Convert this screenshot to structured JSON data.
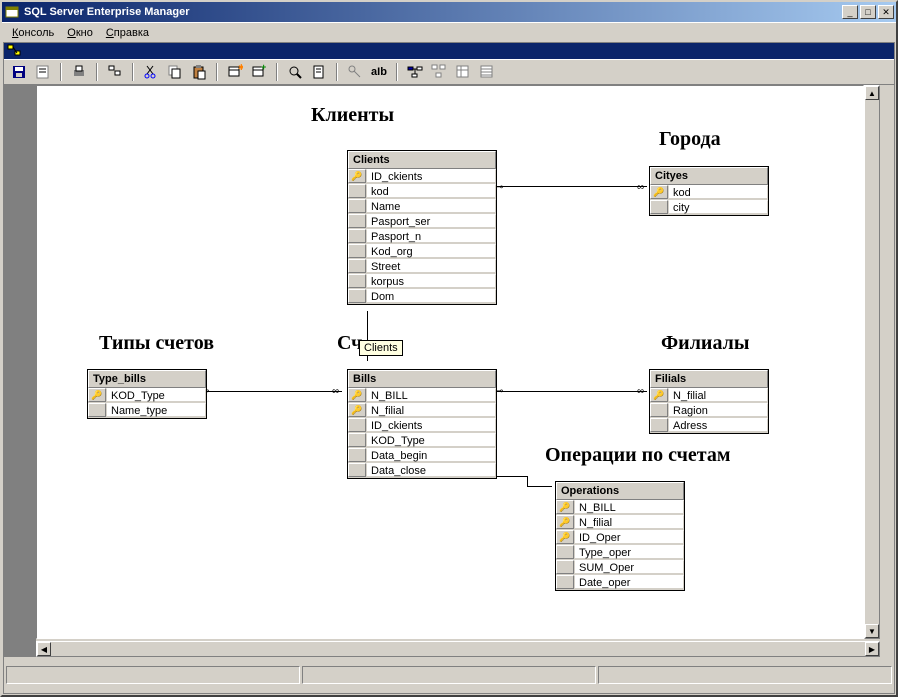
{
  "window": {
    "title": "SQL Server Enterprise Manager"
  },
  "menu": {
    "console": "Консоль",
    "window": "Окно",
    "help": "Справка"
  },
  "toolbar": {
    "alb": "aIb"
  },
  "labels": {
    "clients": "Клиенты",
    "cities": "Города",
    "billtypes": "Типы счетов",
    "accounts": "Сч",
    "branches": "Филиалы",
    "operations": "Операции по счетам"
  },
  "tooltip": "Clients",
  "tables": {
    "clients": {
      "name": "Clients",
      "cols": [
        "ID_ckients",
        "kod",
        "Name",
        "Pasport_ser",
        "Pasport_n",
        "Kod_org",
        "Street",
        "korpus",
        "Dom"
      ],
      "keys": [
        0
      ]
    },
    "cityes": {
      "name": "Cityes",
      "cols": [
        "kod",
        "city"
      ],
      "keys": [
        0
      ]
    },
    "type_bills": {
      "name": "Type_bills",
      "cols": [
        "KOD_Type",
        "Name_type"
      ],
      "keys": [
        0
      ]
    },
    "bills": {
      "name": "Bills",
      "cols": [
        "N_BILL",
        "N_filial",
        "ID_ckients",
        "KOD_Type",
        "Data_begin",
        "Data_close"
      ],
      "keys": [
        0,
        1
      ]
    },
    "filials": {
      "name": "Filials",
      "cols": [
        "N_filial",
        "Ragion",
        "Adress"
      ],
      "keys": [
        0
      ]
    },
    "operations": {
      "name": "Operations",
      "cols": [
        "N_BILL",
        "N_filial",
        "ID_Oper",
        "Type_oper",
        "SUM_Oper",
        "Date_oper"
      ],
      "keys": [
        0,
        1,
        2
      ]
    }
  }
}
